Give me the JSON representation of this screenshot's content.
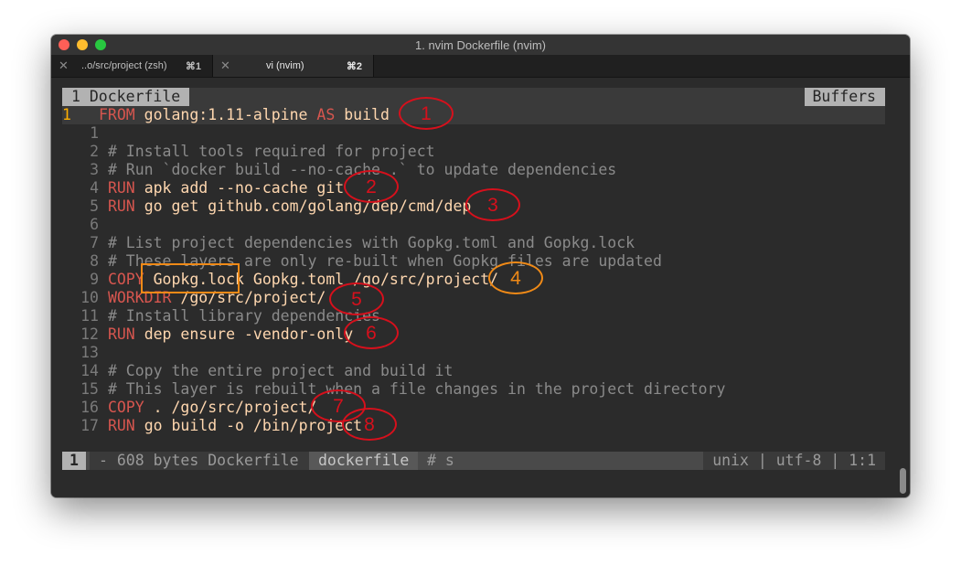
{
  "window": {
    "title": "1. nvim Dockerfile (nvim)",
    "tabs": [
      {
        "label": "..o/src/project (zsh)",
        "shortcut": "⌘1"
      },
      {
        "label": "vi (nvim)",
        "shortcut": "⌘2"
      }
    ]
  },
  "editor": {
    "buffer_tab": "1 Dockerfile",
    "buffers_label": "Buffers",
    "cursor_line_number": "1",
    "lines": [
      {
        "n": "1",
        "kw": "FROM ",
        "text": "golang:1.11-alpine ",
        "kw2": "AS",
        "text2": " build"
      },
      {
        "n": "1",
        "text": ""
      },
      {
        "n": "2",
        "comment": "# Install tools required for project"
      },
      {
        "n": "3",
        "comment": "# Run `docker build --no-cache .` to update dependencies"
      },
      {
        "n": "4",
        "kw": "RUN ",
        "text": "apk add --no-cache git"
      },
      {
        "n": "5",
        "kw": "RUN ",
        "text": "go get github.com/golang/dep/cmd/dep"
      },
      {
        "n": "6",
        "text": ""
      },
      {
        "n": "7",
        "comment": "# List project dependencies with Gopkg.toml and Gopkg.lock"
      },
      {
        "n": "8",
        "comment": "# These layers are only re-built when Gopkg files are updated"
      },
      {
        "n": "9",
        "kw": "COPY ",
        "text": "Gopkg.lock Gopkg.toml /go/src/project/"
      },
      {
        "n": "10",
        "kw": "WORKDIR ",
        "text": "/go/src/project/"
      },
      {
        "n": "11",
        "comment": "# Install library dependencies"
      },
      {
        "n": "12",
        "kw": "RUN ",
        "text": "dep ensure -vendor-only"
      },
      {
        "n": "13",
        "text": ""
      },
      {
        "n": "14",
        "comment": "# Copy the entire project and build it"
      },
      {
        "n": "15",
        "comment": "# This layer is rebuilt when a file changes in the project directory"
      },
      {
        "n": "16",
        "kw": "COPY ",
        "text": ". /go/src/project/"
      },
      {
        "n": "17",
        "kw": "RUN ",
        "text": "go build -o /bin/project"
      }
    ]
  },
  "statusline": {
    "mode": "1",
    "file_info": "- 608 bytes Dockerfile",
    "filetype": "dockerfile",
    "symbol": "# s",
    "right": "unix | utf-8 | 1:1"
  },
  "annotations": [
    {
      "label": "1",
      "color": "#d6101c"
    },
    {
      "label": "2",
      "color": "#d6101c"
    },
    {
      "label": "3",
      "color": "#d6101c"
    },
    {
      "label": "4",
      "color": "#f08a17"
    },
    {
      "label": "5",
      "color": "#d6101c"
    },
    {
      "label": "6",
      "color": "#d6101c"
    },
    {
      "label": "7",
      "color": "#d6101c"
    },
    {
      "label": "8",
      "color": "#d6101c"
    }
  ]
}
